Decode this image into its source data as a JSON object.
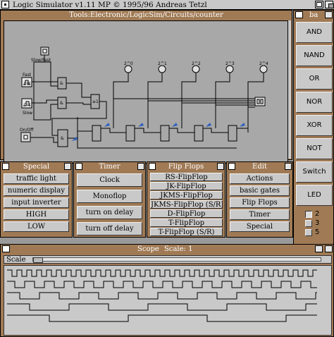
{
  "app": {
    "title": "Logic Simulator v1.11 MP",
    "copyright": "© 1995/96 Andreas Tetzl"
  },
  "circuit_window": {
    "title_prefix": "Tools:",
    "title_path": "Electronic/LogicSim/Circuits/counter",
    "labels": {
      "slow_fast": "Slow/Fast",
      "fast": "Fast",
      "slow": "Slow",
      "on_off": "On/Off",
      "clk1": "CLK",
      "clk2": "CLK",
      "bit0": "2^0",
      "bit1": "2^1",
      "bit2": "2^2",
      "bit3": "2^3",
      "bit4": "2^4",
      "and": "&",
      "or": "≥1"
    }
  },
  "gate_palette": {
    "title": "ba",
    "buttons": [
      "AND",
      "NAND",
      "OR",
      "NOR",
      "XOR",
      "NOT",
      "Switch",
      "LED"
    ],
    "inputs": [
      "2",
      "3",
      "5"
    ]
  },
  "panels": {
    "special": {
      "title": "Special",
      "items": [
        "traffic light",
        "numeric display",
        "input inverter",
        "HIGH",
        "LOW"
      ]
    },
    "timer": {
      "title": "Timer",
      "items": [
        "Clock",
        "Monoflop",
        "turn on delay",
        "turn off delay"
      ]
    },
    "flipflops": {
      "title": "Flip Flops",
      "items": [
        "RS-FlipFlop",
        "JK-FlipFlop",
        "JKMS-FlipFlop",
        "JKMS-FlipFlop (S/R)",
        "D-FlipFlop",
        "T-FlipFlop",
        "T-FlipFlop (S/R)"
      ]
    },
    "edit": {
      "title": "Edit",
      "items": [
        "Actions",
        "basic gates",
        "Flip Flops",
        "Timer",
        "Special"
      ]
    }
  },
  "scope": {
    "title": "Scope",
    "scale_text": "Scale: 1",
    "scale_label": "Scale",
    "signals": [
      {
        "high": [
          [
            0,
            1
          ]
        ]
      },
      {
        "high": [
          [
            0,
            1
          ]
        ]
      },
      {
        "high": [
          [
            0,
            1
          ]
        ]
      },
      {
        "high": [
          [
            0,
            1
          ]
        ]
      },
      {
        "high": [
          [
            0,
            1
          ]
        ]
      }
    ]
  },
  "colors": {
    "window_frame": "#a07a55",
    "panel_bg": "#c9c9c9",
    "canvas_bg": "#a8a8a8",
    "wire": "#000000",
    "arrow_blue": "#3060c0"
  }
}
